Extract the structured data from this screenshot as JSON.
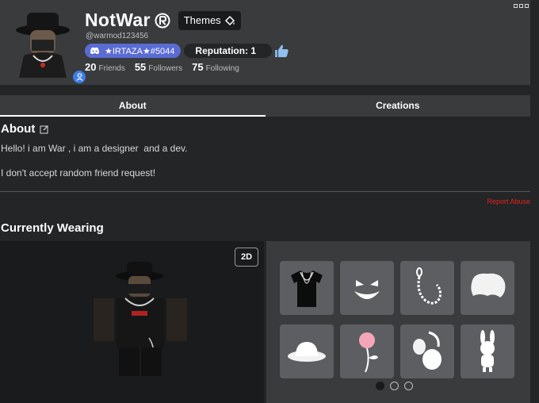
{
  "profile": {
    "display_name": "NotWar",
    "username": "@warmod123456",
    "themes_label": "Themes",
    "discord_tag": "★IRTAZA★#5044",
    "reputation": "Reputation: 1",
    "stats": [
      {
        "count": "20",
        "label": "Friends"
      },
      {
        "count": "55",
        "label": "Followers"
      },
      {
        "count": "75",
        "label": "Following"
      }
    ]
  },
  "tabs": [
    "About",
    "Creations"
  ],
  "about": {
    "heading": "About",
    "bio_line1": "Hello! i am War , i am a designer  and a dev.",
    "bio_line2": "I don't accept random friend request!",
    "report_label": "Report Abuse"
  },
  "wearing": {
    "heading": "Currently Wearing",
    "view_toggle": "2D",
    "items": [
      {
        "icon": "tshirt-icon"
      },
      {
        "icon": "face-icon"
      },
      {
        "icon": "chain-icon"
      },
      {
        "icon": "hair-icon"
      },
      {
        "icon": "hat-icon"
      },
      {
        "icon": "rose-icon"
      },
      {
        "icon": "headphones-icon"
      },
      {
        "icon": "bunny-icon"
      }
    ],
    "pages": 3,
    "current_page": 1
  },
  "colors": {
    "background": "#232527",
    "panel": "#393b3d",
    "discord": "#5a6bd4",
    "report": "#e2231a",
    "item_tile": "#5c5e61"
  }
}
